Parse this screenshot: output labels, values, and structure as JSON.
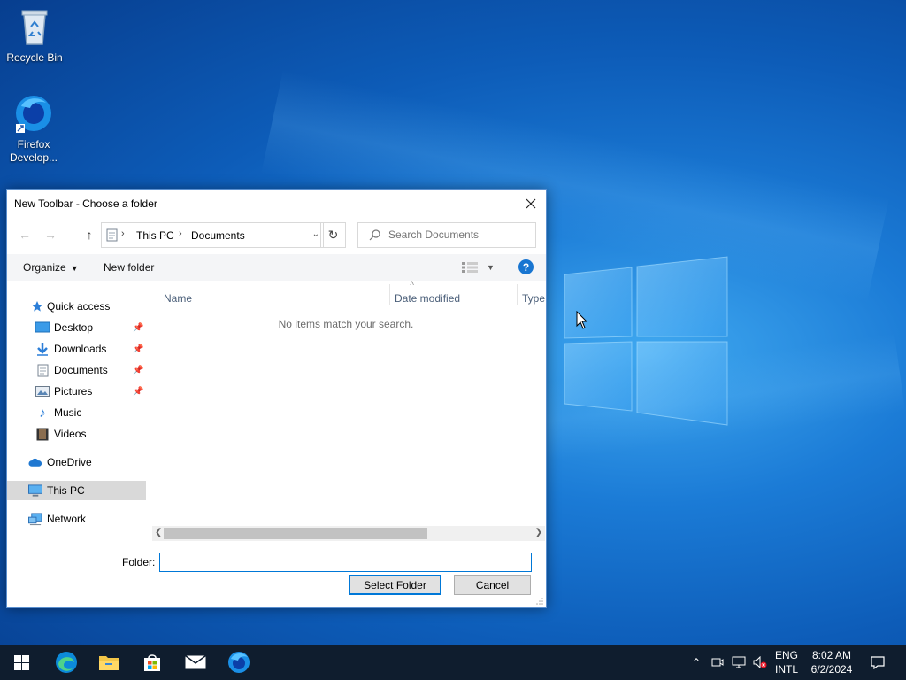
{
  "desktop": {
    "icons": [
      {
        "label": "Recycle Bin"
      },
      {
        "label": "Firefox\nDevelop..."
      }
    ]
  },
  "dialog": {
    "title": "New Toolbar - Choose a folder",
    "address": {
      "items": [
        "This PC",
        "Documents"
      ]
    },
    "search": {
      "placeholder": "Search Documents"
    },
    "toolbar": {
      "organize": "Organize",
      "new_folder": "New folder"
    },
    "sidebar": {
      "quick_access": "Quick access",
      "items": [
        {
          "label": "Desktop",
          "pinned": true
        },
        {
          "label": "Downloads",
          "pinned": true
        },
        {
          "label": "Documents",
          "pinned": true
        },
        {
          "label": "Pictures",
          "pinned": true
        },
        {
          "label": "Music",
          "pinned": false
        },
        {
          "label": "Videos",
          "pinned": false
        }
      ],
      "onedrive": "OneDrive",
      "this_pc": "This PC",
      "network": "Network"
    },
    "columns": [
      "Name",
      "Date modified",
      "Type"
    ],
    "empty_message": "No items match your search.",
    "folder_label": "Folder:",
    "folder_value": "",
    "select_button": "Select Folder",
    "cancel_button": "Cancel"
  },
  "taskbar": {
    "language": "ENG",
    "layout": "INTL",
    "time": "8:02 AM",
    "date": "6/2/2024"
  },
  "colors": {
    "accent": "#0078d7",
    "taskbar": "#0f1d2e",
    "selected_nav": "#d9d9d9"
  }
}
